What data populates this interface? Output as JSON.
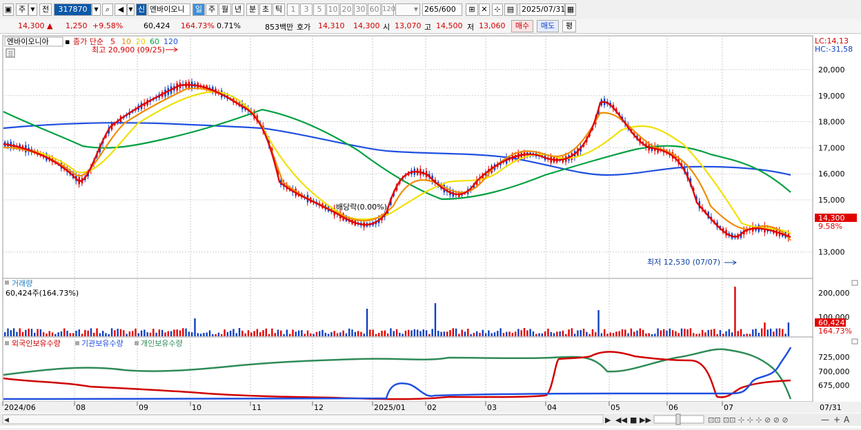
{
  "toolbar": {
    "period_label": "주",
    "prev_label": "전",
    "code_value": "317870",
    "type_badge": "신",
    "stock_name": "엔바이오니",
    "periods": [
      "일",
      "주",
      "월",
      "년",
      "분",
      "초",
      "틱"
    ],
    "numbers": [
      "1",
      "3",
      "5",
      "10",
      "20",
      "30",
      "60",
      "120"
    ],
    "count_value": "265",
    "count_total": "/600",
    "date_value": "2025/07/31"
  },
  "quote": {
    "price": "14,300",
    "change": "1,250",
    "change_pct": "+9.58%",
    "volume": "60,424",
    "volume_pct": "164.73%",
    "turnover_pct": "0.71%",
    "amount": "853백만",
    "ask_label": "호가",
    "ask1": "14,310",
    "ask2": "14,300",
    "open_label": "시",
    "open": "13,070",
    "high_label": "고",
    "high": "14,500",
    "low_label": "저",
    "low": "13,060",
    "buy_label": "매수",
    "sell_label": "매도",
    "eval_label": "평"
  },
  "price_chart": {
    "stock_name": "엔바이오니아",
    "ma_title": "종가 단순",
    "ma_periods": [
      "5",
      "10",
      "20",
      "60",
      "120"
    ],
    "ma_colors": [
      "#e00000",
      "#f08c00",
      "#f0e000",
      "#00a040",
      "#2050e0"
    ],
    "high_note": "최고 20,900 (09/25)",
    "low_note": "최저 12,530 (07/07)",
    "event_note": "배당락(0.00%)",
    "lc_label": "LC:14,13",
    "hc_label": "HC:-31,58",
    "y_ticks": [
      "20,000",
      "19,000",
      "18,000",
      "17,000",
      "16,000",
      "15,000",
      "13,000"
    ],
    "current_price": "14,300",
    "current_pct": "9.58%"
  },
  "volume_chart": {
    "title": "거래량",
    "volume_text": "60,424주(164.73%)",
    "y_ticks": [
      "200,000",
      "100,000"
    ],
    "current_volume": "60,424",
    "current_pct": "164.73%"
  },
  "holdings_chart": {
    "legends": [
      "외국인보유수량",
      "기관보유수량",
      "개인보유수량"
    ],
    "legend_colors": [
      "#d00000",
      "#2050e0",
      "#2e8b57"
    ],
    "y_ticks": [
      "725,000",
      "700,000",
      "675,000"
    ]
  },
  "x_axis": {
    "labels": [
      "2024/06",
      "08",
      "09",
      "10",
      "11",
      "12",
      "2025/01",
      "02",
      "03",
      "04",
      "05",
      "06",
      "07"
    ],
    "right_label": "07/31"
  },
  "colors": {
    "up": "#e00000",
    "down": "#1040c0",
    "panel_bg": "#ffffff"
  }
}
